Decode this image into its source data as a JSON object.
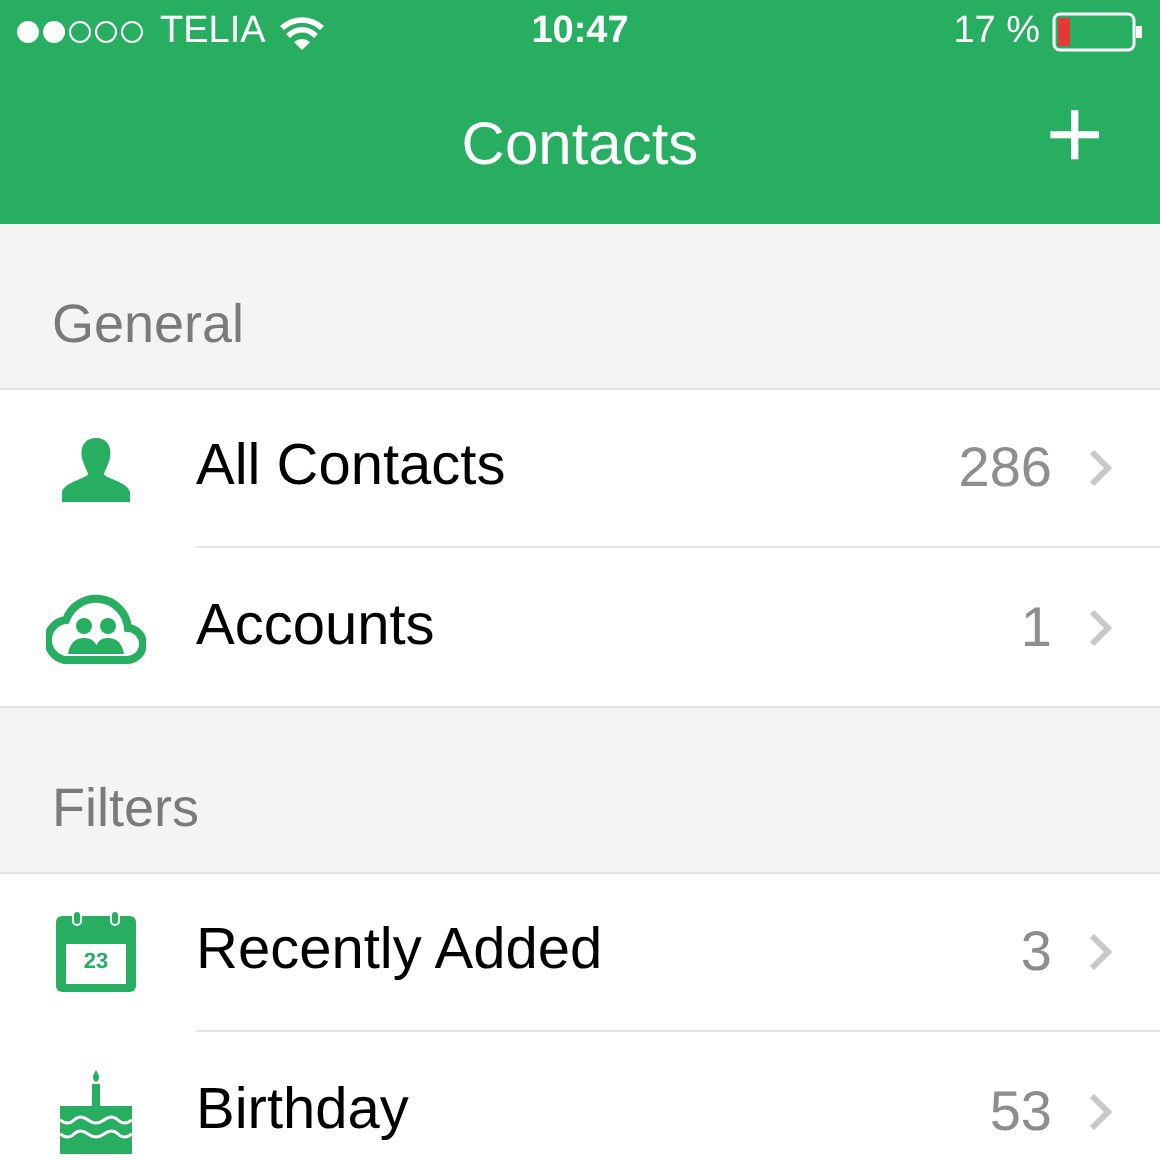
{
  "status_bar": {
    "carrier": "TELIA",
    "time": "10:47",
    "battery": "17 %"
  },
  "nav_bar": {
    "title": "Contacts",
    "action": "+"
  },
  "sections": [
    {
      "header": "General",
      "items": [
        {
          "kind": "person",
          "label": "All Contacts",
          "count": "286"
        },
        {
          "kind": "cloud",
          "label": "Accounts",
          "count": "1"
        }
      ]
    },
    {
      "header": "Filters",
      "items": [
        {
          "kind": "calendar",
          "label": "Recently Added",
          "count": "3",
          "icon_text": "23"
        },
        {
          "kind": "cake",
          "label": "Birthday",
          "count": "53"
        }
      ]
    }
  ]
}
